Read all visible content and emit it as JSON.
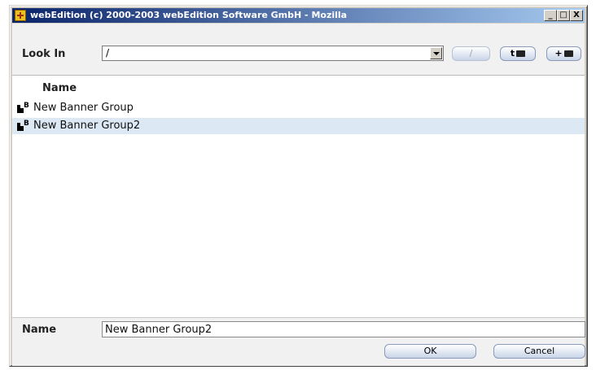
{
  "window": {
    "title": "webEdition (c) 2000-2003 webEdition Software GmbH - Mozilla",
    "controls": {
      "minimize": "_",
      "maximize": "□",
      "close": "X"
    }
  },
  "toolbar": {
    "lookin_label": "Look In",
    "lookin_value": "/",
    "root_button": "/",
    "up_button": "t",
    "new_button": "+"
  },
  "list": {
    "header": "Name",
    "items": [
      {
        "label": "New Banner Group",
        "icon": "banner-group-icon",
        "selected": false
      },
      {
        "label": "New Banner Group2",
        "icon": "banner-group-icon",
        "selected": true
      }
    ]
  },
  "footer": {
    "name_label": "Name",
    "name_value": "New Banner Group2",
    "ok_label": "OK",
    "cancel_label": "Cancel"
  },
  "colors": {
    "title_gradient_start": "#0a246a",
    "title_gradient_end": "#a6caf0",
    "selection": "#dce8f4",
    "panel": "#f1f1f1"
  }
}
